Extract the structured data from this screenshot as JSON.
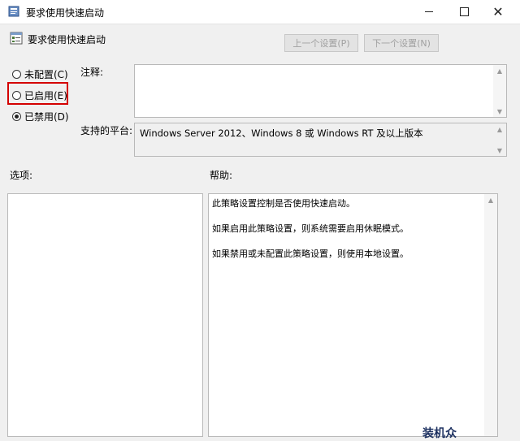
{
  "window": {
    "title": "要求使用快速启动",
    "colors": {
      "accent_highlight": "#d40000",
      "background": "#f0f0f0"
    }
  },
  "header": {
    "title": "要求使用快速启动",
    "prev_button": "上一个设置(P)",
    "next_button": "下一个设置(N)"
  },
  "radios": [
    {
      "label": "未配置(C)",
      "checked": false
    },
    {
      "label": "已启用(E)",
      "checked": false
    },
    {
      "label": "已禁用(D)",
      "checked": true
    }
  ],
  "comment": {
    "label": "注释:",
    "value": ""
  },
  "platform": {
    "label": "支持的平台:",
    "value": "Windows Server 2012、Windows 8 或 Windows RT 及以上版本"
  },
  "options": {
    "label": "选项:"
  },
  "help": {
    "label": "帮助:",
    "paragraphs": [
      "此策略设置控制是否使用快速启动。",
      "如果启用此策略设置，则系统需要启用休眠模式。",
      "如果禁用或未配置此策略设置，则使用本地设置。"
    ]
  },
  "watermark": {
    "text": "装机众"
  },
  "icons": {
    "title": "policy-icon",
    "header": "policy-setting-icon",
    "minimize": "minimize-icon",
    "maximize": "maximize-icon",
    "close": "close-icon"
  }
}
